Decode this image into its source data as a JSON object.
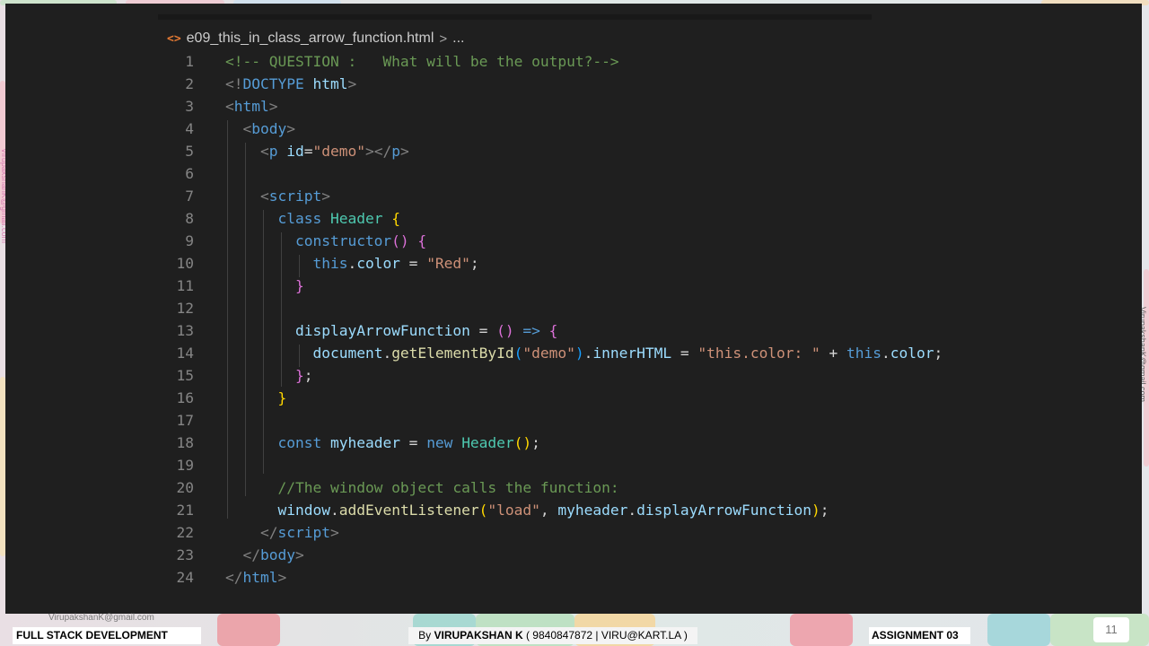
{
  "editor": {
    "breadcrumb": {
      "icon": "html-file-icon",
      "filename": "e09_this_in_class_arrow_function.html",
      "separator": ">",
      "more": "..."
    },
    "lines": [
      {
        "n": "1",
        "tokens": [
          [
            "cm",
            "<!-- QUESTION :   What will be the output?-->"
          ]
        ]
      },
      {
        "n": "2",
        "tokens": [
          [
            "tag",
            "<!"
          ],
          [
            "kw",
            "DOCTYPE"
          ],
          [
            "pun",
            " "
          ],
          [
            "attr",
            "html"
          ],
          [
            "tag",
            ">"
          ]
        ]
      },
      {
        "n": "3",
        "tokens": [
          [
            "tag",
            "<"
          ],
          [
            "el",
            "html"
          ],
          [
            "tag",
            ">"
          ]
        ]
      },
      {
        "n": "4",
        "tokens": [
          [
            "pun",
            "  "
          ],
          [
            "tag",
            "<"
          ],
          [
            "el",
            "body"
          ],
          [
            "tag",
            ">"
          ]
        ]
      },
      {
        "n": "5",
        "tokens": [
          [
            "pun",
            "    "
          ],
          [
            "tag",
            "<"
          ],
          [
            "el",
            "p"
          ],
          [
            "pun",
            " "
          ],
          [
            "attr",
            "id"
          ],
          [
            "pun",
            "="
          ],
          [
            "str",
            "\"demo\""
          ],
          [
            "tag",
            "></"
          ],
          [
            "el",
            "p"
          ],
          [
            "tag",
            ">"
          ]
        ]
      },
      {
        "n": "6",
        "tokens": []
      },
      {
        "n": "7",
        "tokens": [
          [
            "pun",
            "    "
          ],
          [
            "tag",
            "<"
          ],
          [
            "el",
            "script"
          ],
          [
            "tag",
            ">"
          ]
        ]
      },
      {
        "n": "8",
        "tokens": [
          [
            "pun",
            "      "
          ],
          [
            "kw",
            "class"
          ],
          [
            "pun",
            " "
          ],
          [
            "cls",
            "Header"
          ],
          [
            "pun",
            " "
          ],
          [
            "br1",
            "{"
          ]
        ]
      },
      {
        "n": "9",
        "tokens": [
          [
            "pun",
            "        "
          ],
          [
            "kw",
            "constructor"
          ],
          [
            "br2",
            "()"
          ],
          [
            "pun",
            " "
          ],
          [
            "br2",
            "{"
          ]
        ]
      },
      {
        "n": "10",
        "tokens": [
          [
            "pun",
            "          "
          ],
          [
            "kw",
            "this"
          ],
          [
            "pun",
            "."
          ],
          [
            "var",
            "color"
          ],
          [
            "pun",
            " = "
          ],
          [
            "str",
            "\"Red\""
          ],
          [
            "pun",
            ";"
          ]
        ]
      },
      {
        "n": "11",
        "tokens": [
          [
            "pun",
            "        "
          ],
          [
            "br2",
            "}"
          ]
        ]
      },
      {
        "n": "12",
        "tokens": []
      },
      {
        "n": "13",
        "tokens": [
          [
            "pun",
            "        "
          ],
          [
            "var",
            "displayArrowFunction"
          ],
          [
            "pun",
            " = "
          ],
          [
            "br2",
            "()"
          ],
          [
            "pun",
            " "
          ],
          [
            "kw",
            "=>"
          ],
          [
            "pun",
            " "
          ],
          [
            "br2",
            "{"
          ]
        ]
      },
      {
        "n": "14",
        "tokens": [
          [
            "pun",
            "          "
          ],
          [
            "var",
            "document"
          ],
          [
            "pun",
            "."
          ],
          [
            "fn",
            "getElementById"
          ],
          [
            "br3",
            "("
          ],
          [
            "str",
            "\"demo\""
          ],
          [
            "br3",
            ")"
          ],
          [
            "pun",
            "."
          ],
          [
            "var",
            "innerHTML"
          ],
          [
            "pun",
            " = "
          ],
          [
            "str",
            "\"this.color: \""
          ],
          [
            "pun",
            " + "
          ],
          [
            "kw",
            "this"
          ],
          [
            "pun",
            "."
          ],
          [
            "var",
            "color"
          ],
          [
            "pun",
            ";"
          ]
        ]
      },
      {
        "n": "15",
        "tokens": [
          [
            "pun",
            "        "
          ],
          [
            "br2",
            "}"
          ],
          [
            "pun",
            ";"
          ]
        ]
      },
      {
        "n": "16",
        "tokens": [
          [
            "pun",
            "      "
          ],
          [
            "br1",
            "}"
          ]
        ]
      },
      {
        "n": "17",
        "tokens": []
      },
      {
        "n": "18",
        "tokens": [
          [
            "pun",
            "      "
          ],
          [
            "kw",
            "const"
          ],
          [
            "pun",
            " "
          ],
          [
            "var",
            "myheader"
          ],
          [
            "pun",
            " = "
          ],
          [
            "kw",
            "new"
          ],
          [
            "pun",
            " "
          ],
          [
            "cls",
            "Header"
          ],
          [
            "br1",
            "()"
          ],
          [
            "pun",
            ";"
          ]
        ]
      },
      {
        "n": "19",
        "tokens": []
      },
      {
        "n": "20",
        "tokens": [
          [
            "pun",
            "      "
          ],
          [
            "cm",
            "//The window object calls the function:"
          ]
        ]
      },
      {
        "n": "21",
        "tokens": [
          [
            "pun",
            "      "
          ],
          [
            "var",
            "window"
          ],
          [
            "pun",
            "."
          ],
          [
            "fn",
            "addEventListener"
          ],
          [
            "br1",
            "("
          ],
          [
            "str",
            "\"load\""
          ],
          [
            "pun",
            ", "
          ],
          [
            "var",
            "myheader"
          ],
          [
            "pun",
            "."
          ],
          [
            "var",
            "displayArrowFunction"
          ],
          [
            "br1",
            ")"
          ],
          [
            "pun",
            ";"
          ]
        ]
      },
      {
        "n": "22",
        "tokens": [
          [
            "pun",
            "    "
          ],
          [
            "tag",
            "</"
          ],
          [
            "el",
            "script"
          ],
          [
            "tag",
            ">"
          ]
        ]
      },
      {
        "n": "23",
        "tokens": [
          [
            "pun",
            "  "
          ],
          [
            "tag",
            "</"
          ],
          [
            "el",
            "body"
          ],
          [
            "tag",
            ">"
          ]
        ]
      },
      {
        "n": "24",
        "tokens": [
          [
            "tag",
            "</"
          ],
          [
            "el",
            "html"
          ],
          [
            "tag",
            ">"
          ]
        ]
      }
    ]
  },
  "watermark": {
    "left": "VirupakshanK@gmail.com",
    "right": "VirupakshanK@gmail.com",
    "bottom": "VirupakshanK@gmail.com"
  },
  "footer": {
    "course": "FULL STACK DEVELOPMENT",
    "by_prefix": "By ",
    "author": "VIRUPAKSHAN K",
    "contact": " ( 9840847872 | VIRU@KART.LA )",
    "assignment": "ASSIGNMENT 03",
    "page_number": "11"
  }
}
